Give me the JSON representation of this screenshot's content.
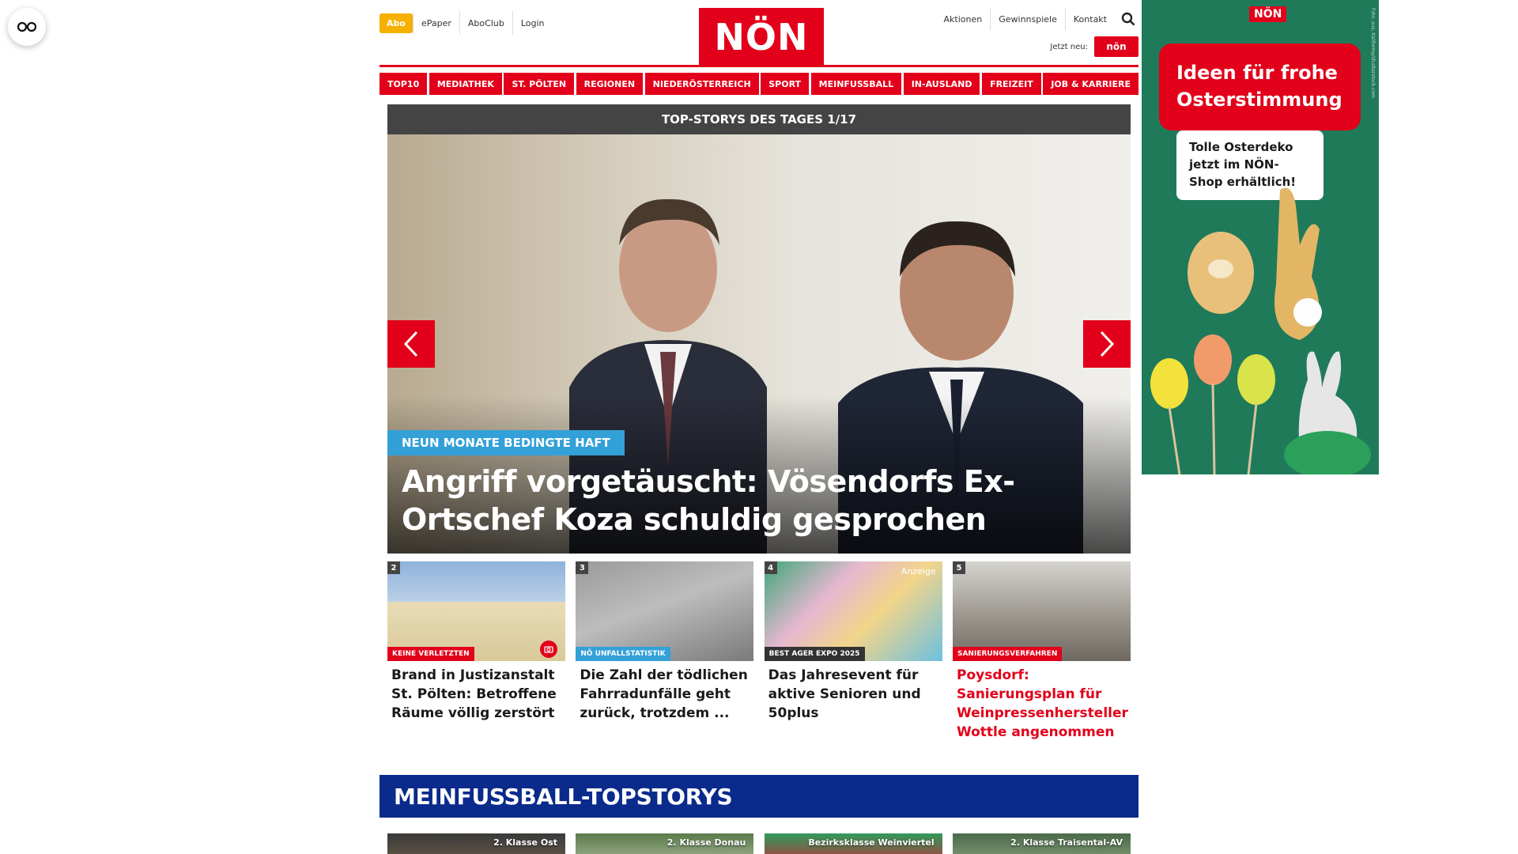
{
  "header": {
    "abo": "Abo",
    "left_links": [
      "ePaper",
      "AboClub",
      "Login"
    ],
    "logo": "NÖN",
    "right_links": [
      "Aktionen",
      "Gewinnspiele",
      "Kontakt"
    ],
    "jetzt_label": "Jetzt neu:",
    "jetzt_badge": "nön"
  },
  "nav": [
    "TOP10",
    "MEDIATHEK",
    "ST. PÖLTEN",
    "REGIONEN",
    "NIEDERÖSTERREICH",
    "SPORT",
    "MEINFUSSBALL",
    "IN-AUSLAND",
    "FREIZEIT",
    "JOB & KARRIERE"
  ],
  "topstories": {
    "header": "TOP-STORYS DES TAGES 1/17",
    "hero_tag": "NEUN MONATE BEDINGTE HAFT",
    "hero_title": "Angriff vorgetäuscht: Vösendorfs Ex-Ortschef Koza schuldig gesprochen"
  },
  "cards": [
    {
      "num": "2",
      "kicker": "KEINE VERLETZTEN",
      "kicker_color": "#e2001a",
      "title": "Brand in Justizanstalt St. Pölten: Betroffene Räume völlig zerstört",
      "title_red": false,
      "anzeige": ""
    },
    {
      "num": "3",
      "kicker": "NÖ UNFALLSTATISTIK",
      "kicker_color": "#33a0d8",
      "title": "Die Zahl der tödlichen Fahrradunfälle geht zurück, trotzdem ...",
      "title_red": false,
      "anzeige": ""
    },
    {
      "num": "4",
      "kicker": "BEST AGER EXPO 2025",
      "kicker_color": "#333333",
      "title": "Das Jahresevent für aktive Senioren und 50plus",
      "title_red": false,
      "anzeige": "Anzeige"
    },
    {
      "num": "5",
      "kicker": "SANIERUNGSVERFAHREN",
      "kicker_color": "#e2001a",
      "title": "Poysdorf: Sanierungsplan für Weinpressenhersteller Wottle angenommen",
      "title_red": true,
      "anzeige": ""
    }
  ],
  "meinfussball": {
    "title": "MEINFUSSBALL-TOPSTORYS",
    "cards": [
      "2. Klasse Ost",
      "2. Klasse Donau",
      "Bezirksklasse Weinviertel",
      "2. Klasse Traisental-AV"
    ]
  },
  "ad": {
    "logo": "NÖN",
    "headline": "Ideen für frohe Osterstimmung",
    "sub": "Tolle Osterdeko jetzt im NÖN-Shop erhältlich!",
    "credit": "Foto: aus, Kaliformy/shutterstock.com"
  },
  "colors": {
    "brand": "#e2001a",
    "abo": "#f6b000",
    "mf": "#0a2a8c",
    "tag": "#33a0d8"
  }
}
